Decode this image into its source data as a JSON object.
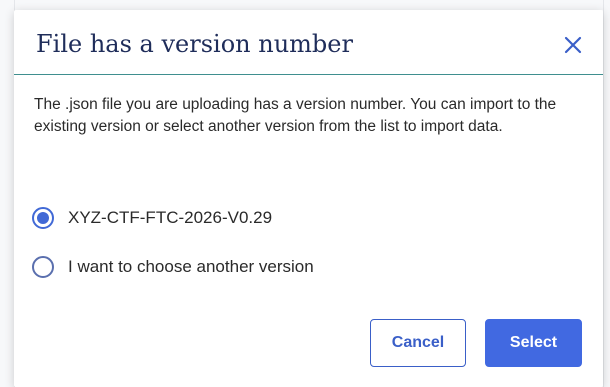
{
  "dialog": {
    "title": "File has a version number",
    "close_icon": "close-icon",
    "message": "The .json file you are uploading has a version number. You can import to the existing version or select another version from the list to import data.",
    "options": [
      {
        "label": "XYZ-CTF-FTC-2026-V0.29",
        "selected": true
      },
      {
        "label": "I want to choose another version",
        "selected": false
      }
    ],
    "buttons": {
      "cancel_label": "Cancel",
      "select_label": "Select"
    }
  },
  "colors": {
    "title": "#1f2d5a",
    "accent": "#4169e1",
    "header_divider": "#3f8f8f",
    "close_icon": "#3a5fc8"
  }
}
